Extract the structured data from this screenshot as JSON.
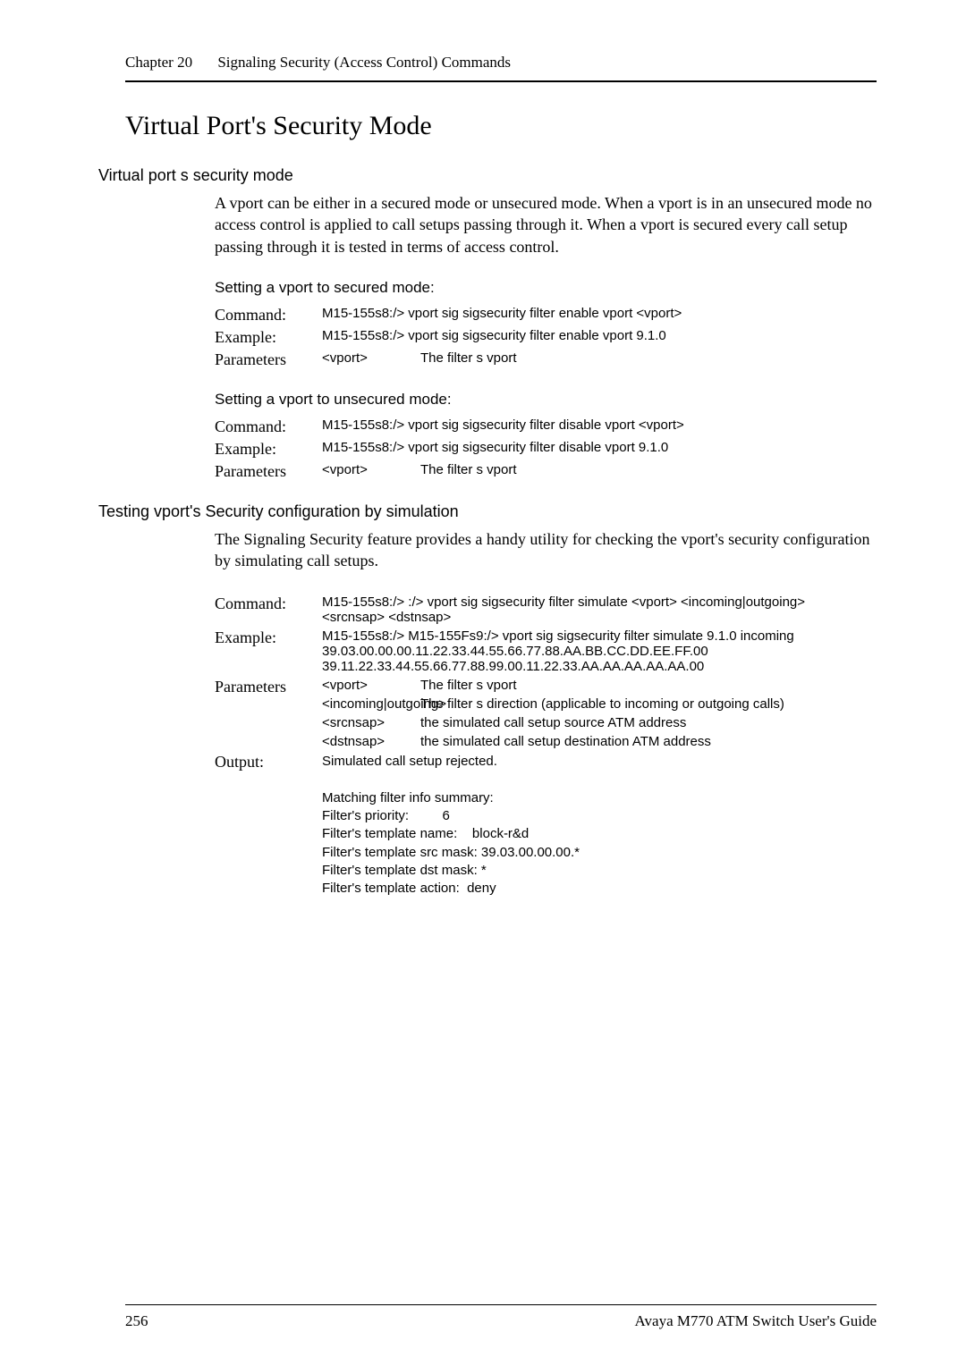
{
  "header": {
    "chapter_label": "Chapter 20",
    "chapter_title": "Signaling Security (Access Control) Commands"
  },
  "title": "Virtual Port's Security Mode",
  "sec1": {
    "heading": "Virtual port s security mode",
    "body": "A vport can be either in a secured mode or unsecured mode. When a vport is in an unsecured mode no access control is applied to call setups passing through it. When a vport is secured every call setup passing through it is tested in terms of access control."
  },
  "secured": {
    "label": "Setting a vport to secured mode:",
    "command_key": "Command:",
    "command_val": "M15-155s8:/> vport sig sigsecurity filter enable vport <vport>",
    "example_key": "Example:",
    "example_val": "M15-155s8:/> vport sig sigsecurity filter enable vport 9.1.0",
    "params_key": "Parameters",
    "p1_name": "<vport>",
    "p1_desc": "The filter s vport"
  },
  "unsecured": {
    "label": "Setting a vport to unsecured mode:",
    "command_key": "Command:",
    "command_val": "M15-155s8:/> vport sig sigsecurity filter disable vport <vport>",
    "example_key": "Example:",
    "example_val": "M15-155s8:/> vport sig sigsecurity filter disable vport 9.1.0",
    "params_key": "Parameters",
    "p1_name": "<vport>",
    "p1_desc": "The filter s vport"
  },
  "testing": {
    "heading": "Testing vport's Security configuration by simulation",
    "body": "The Signaling Security feature provides a handy utility for checking the vport's security configuration by simulating call setups.",
    "command_key": "Command:",
    "command_val": "M15-155s8:/> :/> vport sig sigsecurity filter simulate <vport> <incoming|outgoing> <srcnsap> <dstnsap>",
    "example_key": "Example:",
    "example_val": "M15-155s8:/> M15-155Fs9:/> vport sig sigsecurity filter simulate 9.1.0 incoming 39.03.00.00.00.11.22.33.44.55.66.77.88.AA.BB.CC.DD.EE.FF.00 39.11.22.33.44.55.66.77.88.99.00.11.22.33.AA.AA.AA.AA.AA.00",
    "params_key": "Parameters",
    "p1_name": "<vport>",
    "p1_desc": "The filter s vport",
    "p2_name": "<incoming|outgoing>",
    "p2_desc": "The filter s direction (applicable to incoming or outgoing calls)",
    "p3_name": "<srcnsap>",
    "p3_desc": "the simulated call setup source ATM address",
    "p4_name": "<dstnsap>",
    "p4_desc": "the simulated call setup destination ATM address",
    "output_key": "Output:",
    "output_val": "Simulated call setup rejected.\n\nMatching filter info summary:\nFilter's priority:         6\nFilter's template name:    block-r&d\nFilter's template src mask: 39.03.00.00.00.*\nFilter's template dst mask: *\nFilter's template action:  deny"
  },
  "footer": {
    "page": "256",
    "right": "Avaya M770 ATM Switch User's Guide"
  }
}
